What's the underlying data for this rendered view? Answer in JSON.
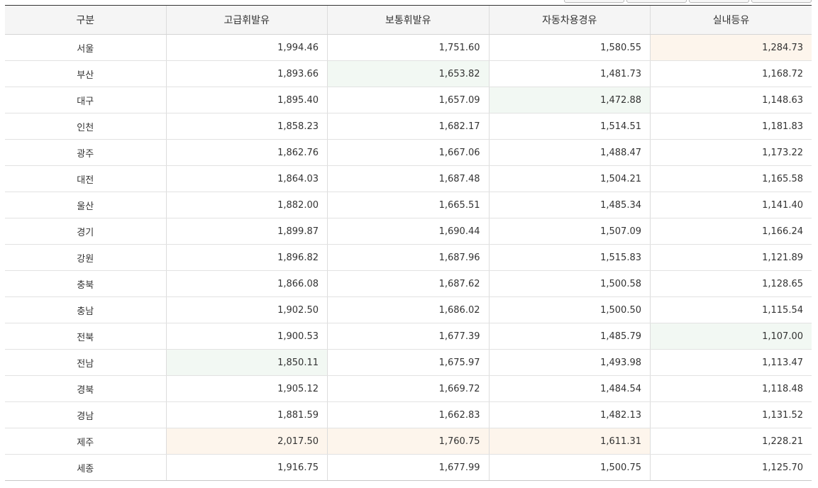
{
  "colors": {
    "highest_highlight": "#fdf5ec",
    "lowest_highlight": "#f2f8f3",
    "header_background": "#f5f5f5",
    "header_top_border": "#333333"
  },
  "table": {
    "headers": [
      "구분",
      "고급휘발유",
      "보통휘발유",
      "자동차용경유",
      "실내등유"
    ],
    "rows": [
      {
        "region": "서울",
        "values": [
          "1,994.46",
          "1,751.60",
          "1,580.55",
          "1,284.73"
        ],
        "highlight": [
          "",
          "",
          "",
          "max"
        ]
      },
      {
        "region": "부산",
        "values": [
          "1,893.66",
          "1,653.82",
          "1,481.73",
          "1,168.72"
        ],
        "highlight": [
          "",
          "min",
          "",
          ""
        ]
      },
      {
        "region": "대구",
        "values": [
          "1,895.40",
          "1,657.09",
          "1,472.88",
          "1,148.63"
        ],
        "highlight": [
          "",
          "",
          "min",
          ""
        ]
      },
      {
        "region": "인천",
        "values": [
          "1,858.23",
          "1,682.17",
          "1,514.51",
          "1,181.83"
        ],
        "highlight": [
          "",
          "",
          "",
          ""
        ]
      },
      {
        "region": "광주",
        "values": [
          "1,862.76",
          "1,667.06",
          "1,488.47",
          "1,173.22"
        ],
        "highlight": [
          "",
          "",
          "",
          ""
        ]
      },
      {
        "region": "대전",
        "values": [
          "1,864.03",
          "1,687.48",
          "1,504.21",
          "1,165.58"
        ],
        "highlight": [
          "",
          "",
          "",
          ""
        ]
      },
      {
        "region": "울산",
        "values": [
          "1,882.00",
          "1,665.51",
          "1,485.34",
          "1,141.40"
        ],
        "highlight": [
          "",
          "",
          "",
          ""
        ]
      },
      {
        "region": "경기",
        "values": [
          "1,899.87",
          "1,690.44",
          "1,507.09",
          "1,166.24"
        ],
        "highlight": [
          "",
          "",
          "",
          ""
        ]
      },
      {
        "region": "강원",
        "values": [
          "1,896.82",
          "1,687.96",
          "1,515.83",
          "1,121.89"
        ],
        "highlight": [
          "",
          "",
          "",
          ""
        ]
      },
      {
        "region": "충북",
        "values": [
          "1,866.08",
          "1,687.62",
          "1,500.58",
          "1,128.65"
        ],
        "highlight": [
          "",
          "",
          "",
          ""
        ]
      },
      {
        "region": "충남",
        "values": [
          "1,902.50",
          "1,686.02",
          "1,500.50",
          "1,115.54"
        ],
        "highlight": [
          "",
          "",
          "",
          ""
        ]
      },
      {
        "region": "전북",
        "values": [
          "1,900.53",
          "1,677.39",
          "1,485.79",
          "1,107.00"
        ],
        "highlight": [
          "",
          "",
          "",
          "min"
        ]
      },
      {
        "region": "전남",
        "values": [
          "1,850.11",
          "1,675.97",
          "1,493.98",
          "1,113.47"
        ],
        "highlight": [
          "min",
          "",
          "",
          ""
        ]
      },
      {
        "region": "경북",
        "values": [
          "1,905.12",
          "1,669.72",
          "1,484.54",
          "1,118.48"
        ],
        "highlight": [
          "",
          "",
          "",
          ""
        ]
      },
      {
        "region": "경남",
        "values": [
          "1,881.59",
          "1,662.83",
          "1,482.13",
          "1,131.52"
        ],
        "highlight": [
          "",
          "",
          "",
          ""
        ]
      },
      {
        "region": "제주",
        "values": [
          "2,017.50",
          "1,760.75",
          "1,611.31",
          "1,228.21"
        ],
        "highlight": [
          "max",
          "max",
          "max",
          ""
        ]
      },
      {
        "region": "세종",
        "values": [
          "1,916.75",
          "1,677.99",
          "1,500.75",
          "1,125.70"
        ],
        "highlight": [
          "",
          "",
          "",
          ""
        ]
      }
    ]
  }
}
